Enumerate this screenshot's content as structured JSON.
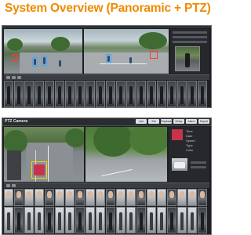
{
  "header": {
    "title": "System Overview (Panoramic + PTZ)"
  },
  "colors": {
    "title": "#f08a00",
    "frame": "#1d1f22",
    "detect_box": "#3fa9ff",
    "alert_box": "#ff3b30",
    "target_box": "#ffd400"
  },
  "top_panel": {
    "views": [
      {
        "name": "panoramic-view-left"
      },
      {
        "name": "panoramic-view-right"
      }
    ],
    "side_thumbnail": "ptz-preview",
    "thumbnails_count": 20
  },
  "bottom_panel": {
    "brand": "PTZ Camera",
    "tabs": [
      "Live",
      "Set",
      "Playback",
      "Setup",
      "Alarm",
      "Export"
    ],
    "info_labels": [
      "Time",
      "Date",
      "Speed",
      "Type",
      "Color"
    ],
    "thumbnails_count": 20
  },
  "icons": {
    "play": "play-icon",
    "stop": "stop-icon",
    "zoom": "zoom-icon"
  }
}
